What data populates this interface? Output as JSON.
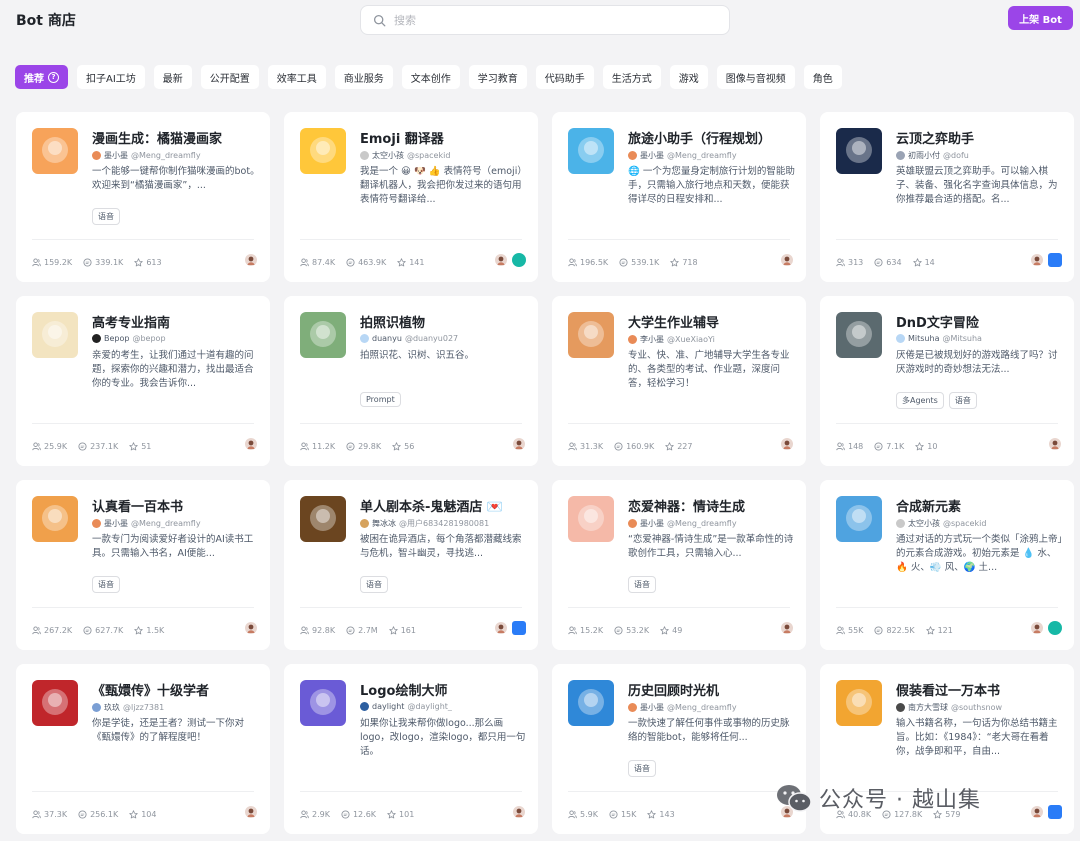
{
  "header": {
    "title": "Bot 商店",
    "search_placeholder": "搜索",
    "publish_label": "上架 Bot"
  },
  "tabs": [
    {
      "label": "推荐",
      "active": true
    },
    {
      "label": "扣子AI工坊"
    },
    {
      "label": "最新"
    },
    {
      "label": "公开配置"
    },
    {
      "label": "效率工具"
    },
    {
      "label": "商业服务"
    },
    {
      "label": "文本创作"
    },
    {
      "label": "学习教育"
    },
    {
      "label": "代码助手"
    },
    {
      "label": "生活方式"
    },
    {
      "label": "游戏"
    },
    {
      "label": "图像与音视频"
    },
    {
      "label": "角色"
    }
  ],
  "cards": [
    {
      "title": "漫画生成：橘猫漫画家",
      "author": "墨小墨",
      "handle": "@Meng_dreamfly",
      "desc": "一个能够一键帮你制作猫咪漫画的bot。欢迎来到“橘猫漫画家”，...",
      "tags": [
        "语音"
      ],
      "users": "159.2K",
      "chats": "339.1K",
      "stars": "613",
      "icons": [
        "avatar"
      ],
      "color": "#f7a35a",
      "dot": "#e98b57"
    },
    {
      "title": "Emoji 翻译器",
      "author": "太空小孩",
      "handle": "@spacekid",
      "desc": "我是一个 😀 🐶 👍 表情符号（emoji）翻译机器人，我会把你发过来的语句用表情符号翻译给...",
      "tags": [],
      "users": "87.4K",
      "chats": "463.9K",
      "stars": "141",
      "icons": [
        "avatar",
        "chat"
      ],
      "color": "#ffc73a",
      "dot": "#c9c9c9"
    },
    {
      "title": "旅途小助手（行程规划）",
      "author": "墨小墨",
      "handle": "@Meng_dreamfly",
      "desc": "🌐 一个为您量身定制旅行计划的智能助手，只需输入旅行地点和天数，便能获得详尽的日程安排和...",
      "tags": [],
      "users": "196.5K",
      "chats": "539.1K",
      "stars": "718",
      "icons": [
        "avatar"
      ],
      "color": "#4bb3e8",
      "dot": "#e98b57"
    },
    {
      "title": "云顶之弈助手",
      "author": "初雨小付",
      "handle": "@dofu",
      "desc": "英雄联盟云顶之弈助手。可以输入棋子、装备、强化名字查询具体信息，为你推荐最合适的搭配。名...",
      "tags": [],
      "users": "313",
      "chats": "634",
      "stars": "14",
      "icons": [
        "avatar",
        "feishu"
      ],
      "color": "#1a2a4a",
      "dot": "#9aa3b4"
    },
    {
      "title": "高考专业指南",
      "author": "Bepop",
      "handle": "@bepop",
      "desc": "亲爱的考生，让我们通过十道有趣的问题，探索你的兴趣和潜力，找出最适合你的专业。我会告诉你...",
      "tags": [],
      "users": "25.9K",
      "chats": "237.1K",
      "stars": "51",
      "icons": [
        "avatar"
      ],
      "color": "#f3e4c0",
      "dot": "#222222"
    },
    {
      "title": "拍照识植物",
      "author": "duanyu",
      "handle": "@duanyu027",
      "desc": "拍照识花、识树、识五谷。",
      "tags": [
        "Prompt"
      ],
      "users": "11.2K",
      "chats": "29.8K",
      "stars": "56",
      "icons": [
        "avatar"
      ],
      "color": "#7fae7a",
      "dot": "#b8d7f5"
    },
    {
      "title": "大学生作业辅导",
      "author": "李小墨",
      "handle": "@XueXiaoYi",
      "desc": "专业、快、准、广地辅导大学生各专业的、各类型的考试、作业题，深度问答，轻松学习！",
      "tags": [],
      "users": "31.3K",
      "chats": "160.9K",
      "stars": "227",
      "icons": [
        "avatar"
      ],
      "color": "#e59a5e",
      "dot": "#e98b57"
    },
    {
      "title": "DnD文字冒险",
      "author": "Mitsuha",
      "handle": "@Mitsuha",
      "desc": "厌倦是已被规划好的游戏路线了吗？讨厌游戏时的奇妙想法无法...",
      "tags": [
        "多Agents",
        "语音"
      ],
      "users": "148",
      "chats": "7.1K",
      "stars": "10",
      "icons": [
        "avatar"
      ],
      "color": "#5b6a6f",
      "dot": "#b8d7f5"
    },
    {
      "title": "认真看一百本书",
      "author": "墨小墨",
      "handle": "@Meng_dreamfly",
      "desc": "一款专门为阅读爱好者设计的AI读书工具。只需输入书名，AI便能...",
      "tags": [
        "语音"
      ],
      "users": "267.2K",
      "chats": "627.7K",
      "stars": "1.5K",
      "icons": [
        "avatar"
      ],
      "color": "#f0a04b",
      "dot": "#e98b57"
    },
    {
      "title": "单人剧本杀-鬼魅酒店 💌",
      "author": "舞冰冰",
      "handle": "@用户6834281980081",
      "desc": "被困在诡异酒店，每个角落都潜藏线索与危机，智斗幽灵，寻找逃...",
      "tags": [
        "语音"
      ],
      "users": "92.8K",
      "chats": "2.7M",
      "stars": "161",
      "icons": [
        "avatar",
        "feishu"
      ],
      "color": "#6b4520",
      "dot": "#d6a35e"
    },
    {
      "title": "恋爱神器：情诗生成",
      "author": "墨小墨",
      "handle": "@Meng_dreamfly",
      "desc": "“恋爱神器-情诗生成”是一款革命性的诗歌创作工具，只需输入心...",
      "tags": [
        "语音"
      ],
      "users": "15.2K",
      "chats": "53.2K",
      "stars": "49",
      "icons": [
        "avatar"
      ],
      "color": "#f5b9a8",
      "dot": "#e98b57"
    },
    {
      "title": "合成新元素",
      "author": "太空小孩",
      "handle": "@spacekid",
      "desc": "通过对话的方式玩一个类似「涂鸦上帝」的元素合成游戏。初始元素是 💧 水、🔥 火、💨 风、🌍 土...",
      "tags": [],
      "users": "55K",
      "chats": "822.5K",
      "stars": "121",
      "icons": [
        "avatar",
        "chat"
      ],
      "color": "#4fa3e0",
      "dot": "#c9c9c9"
    },
    {
      "title": "《甄嬛传》十级学者",
      "author": "玖玖",
      "handle": "@ljzz7381",
      "desc": "你是学徒，还是王者？测试一下你对《甄嬛传》的了解程度吧！",
      "tags": [],
      "users": "37.3K",
      "chats": "256.1K",
      "stars": "104",
      "icons": [
        "avatar"
      ],
      "color": "#c0262b",
      "dot": "#7b9fd4"
    },
    {
      "title": "Logo绘制大师",
      "author": "daylight",
      "handle": "@daylight_",
      "desc": "如果你让我来帮你做logo...那么画logo，改logo，渲染logo，都只用一句话。",
      "tags": [],
      "users": "2.9K",
      "chats": "12.6K",
      "stars": "101",
      "icons": [
        "avatar"
      ],
      "color": "#6a5bd6",
      "dot": "#2d5fa0"
    },
    {
      "title": "历史回顾时光机",
      "author": "墨小墨",
      "handle": "@Meng_dreamfly",
      "desc": "一款快速了解任何事件或事物的历史脉络的智能bot，能够将任何...",
      "tags": [
        "语音"
      ],
      "users": "5.9K",
      "chats": "15K",
      "stars": "143",
      "icons": [
        "avatar"
      ],
      "color": "#2f88d8",
      "dot": "#e98b57"
    },
    {
      "title": "假装看过一万本书",
      "author": "南方大雪球",
      "handle": "@southsnow",
      "desc": "输入书籍名称，一句话为你总结书籍主旨。比如：《1984》：“老大哥在看着你，战争即和平，自由...",
      "tags": [],
      "users": "40.8K",
      "chats": "127.8K",
      "stars": "579",
      "icons": [
        "avatar",
        "feishu"
      ],
      "color": "#f2a531",
      "dot": "#4a4a4a"
    }
  ],
  "watermark": {
    "text": "公众号 · 越山集"
  }
}
